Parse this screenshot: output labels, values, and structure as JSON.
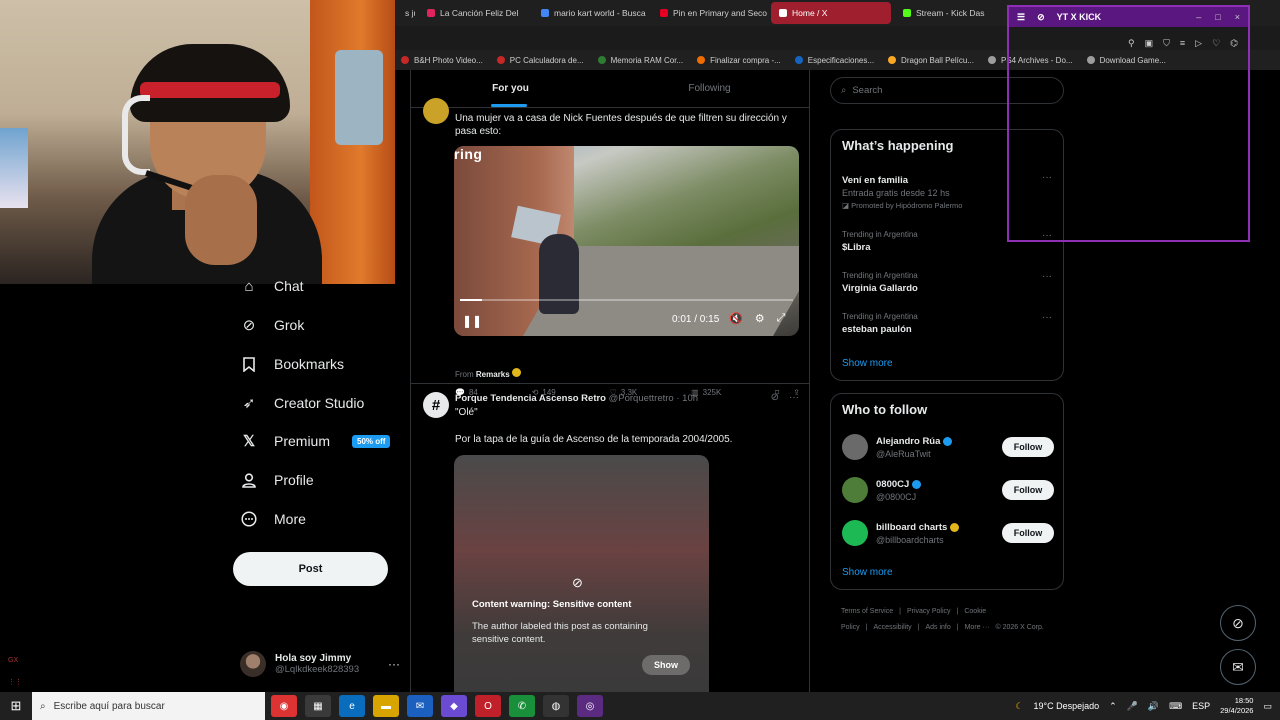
{
  "browser": {
    "tabs": [
      {
        "label": "s ju",
        "color": "#777777",
        "active": false
      },
      {
        "label": "La Canción Feliz Del",
        "color": "#e0245e",
        "active": false
      },
      {
        "label": "mario kart world - Busca",
        "color": "#4285f4",
        "active": false
      },
      {
        "label": "Pin en Primary and Seco",
        "color": "#e60023",
        "active": false
      },
      {
        "label": "Home / X",
        "color": "#ffffff",
        "active": true
      },
      {
        "label": "Stream - Kick Das",
        "color": "#53fc18",
        "active": false
      }
    ],
    "bookmarks": [
      {
        "label": "B&H Photo Video...",
        "color": "#c62828"
      },
      {
        "label": "PC Calculadora de...",
        "color": "#c62828"
      },
      {
        "label": "Memoria RAM Cor...",
        "color": "#2e7d32"
      },
      {
        "label": "Finalizar compra -...",
        "color": "#ef6c00"
      },
      {
        "label": "Especificaciones...",
        "color": "#1565c0"
      },
      {
        "label": "Dragon Ball Pelícu...",
        "color": "#f9a825"
      },
      {
        "label": "PS4 Archives - Do...",
        "color": "#9e9e9e"
      },
      {
        "label": "Download Game...",
        "color": "#9e9e9e"
      }
    ]
  },
  "extension": {
    "title": "YT X KICK"
  },
  "sidebar": {
    "items": [
      {
        "label": "Chat",
        "icon": "chat-icon"
      },
      {
        "label": "Grok",
        "icon": "grok-icon"
      },
      {
        "label": "Bookmarks",
        "icon": "bookmark-icon"
      },
      {
        "label": "Creator Studio",
        "icon": "rocket-icon"
      },
      {
        "label": "Premium",
        "icon": "x-logo-icon",
        "badge": "50% off"
      },
      {
        "label": "Profile",
        "icon": "person-icon"
      },
      {
        "label": "More",
        "icon": "more-circle-icon"
      }
    ],
    "post_label": "Post",
    "account": {
      "name": "Hola soy Jimmy",
      "handle": "@Lqlkdkeek828393"
    }
  },
  "feed": {
    "tabs": [
      "For you",
      "Following"
    ],
    "post1": {
      "text": "Una mujer va a casa de Nick Fuentes después de que filtren su dirección y pasa esto:",
      "video": {
        "brand": "ring",
        "time": "0:01 / 0:15",
        "progress": 0.067
      },
      "from_label": "From",
      "from_account": "Remarks",
      "stats": {
        "replies": "84",
        "reposts": "149",
        "likes": "3.3K",
        "views": "325K"
      }
    },
    "post2": {
      "name": "Porque Tendencia Ascenso Retro",
      "handle": "@Porquettretro · 10h",
      "quote": "\"Olé\"",
      "text": "Por la tapa de la guía de Ascenso de la temporada 2004/2005.",
      "warning_title": "Content warning: Sensitive content",
      "warning_text": "The author labeled this post as containing sensitive content.",
      "show_label": "Show"
    }
  },
  "right": {
    "search_placeholder": "Search",
    "happening_title": "What’s happening",
    "trends": [
      {
        "meta": "",
        "name": "Vení en familia",
        "sub": "Entrada gratis desde 12 hs",
        "promo": "Promoted by Hipódromo Palermo"
      },
      {
        "meta": "Trending in Argentina",
        "name": "$Libra",
        "sub": "",
        "promo": ""
      },
      {
        "meta": "Trending in Argentina",
        "name": "Virginia Gallardo",
        "sub": "",
        "promo": ""
      },
      {
        "meta": "Trending in Argentina",
        "name": "esteban paulón",
        "sub": "",
        "promo": ""
      }
    ],
    "show_more": "Show more",
    "follow_title": "Who to follow",
    "follow": [
      {
        "name": "Alejandro Rúa",
        "handle": "@AleRuaTwit",
        "color": "#6a6a6a",
        "verified": "blue"
      },
      {
        "name": "0800CJ",
        "handle": "@0800CJ",
        "color": "#4e7d3a",
        "verified": "blue"
      },
      {
        "name": "billboard charts",
        "handle": "@billboardcharts",
        "color": "#1db954",
        "verified": "gold"
      }
    ],
    "follow_label": "Follow",
    "footer": [
      "Terms of Service",
      "|",
      "Privacy Policy",
      "|",
      "Cookie Policy",
      "|",
      "Accessibility",
      "|",
      "Ads info",
      "|",
      "More ···",
      "© 2026 X Corp."
    ]
  },
  "taskbar": {
    "search_placeholder": "Escribe aquí para buscar",
    "weather": "19°C  Despejado",
    "lang": "ESP",
    "time": "18:50",
    "date": "29/4/2026"
  },
  "overlay": {
    "gx": "GX"
  }
}
